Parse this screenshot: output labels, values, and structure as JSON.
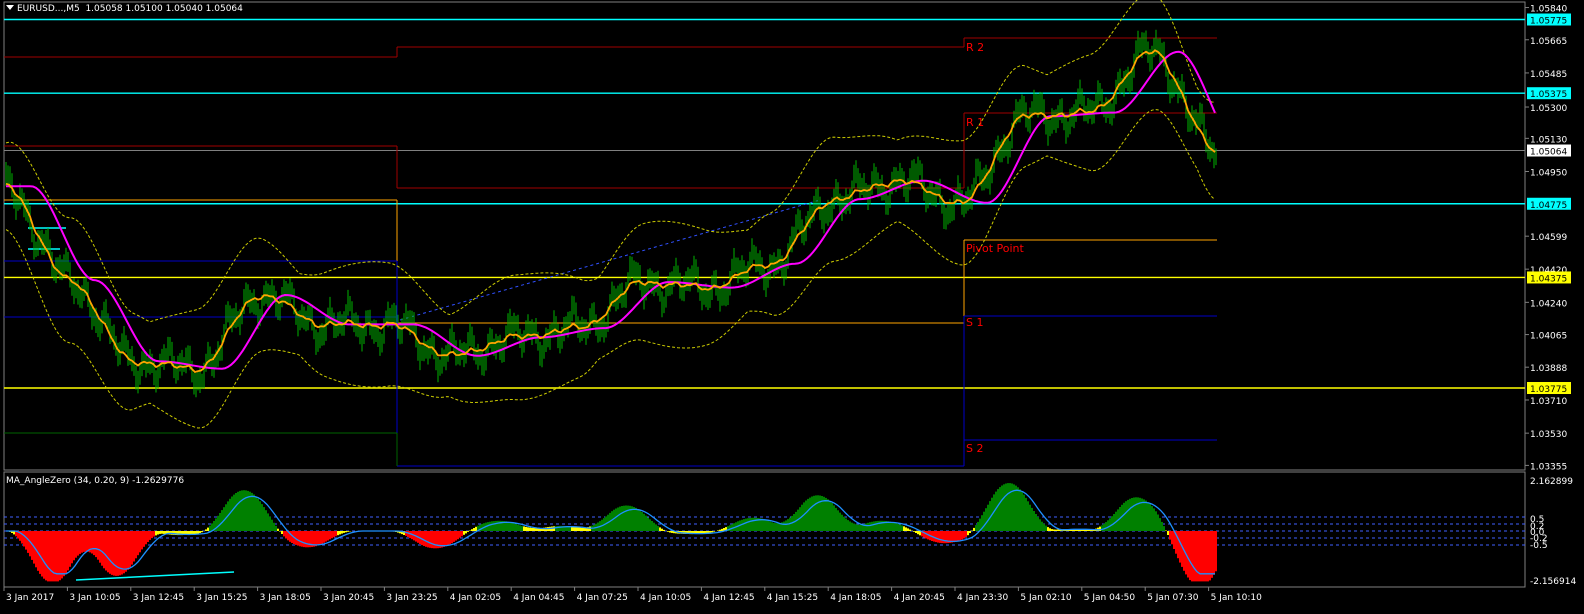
{
  "main_panel": {
    "symbol_label": "EURUSD...,M5",
    "ohlc": "1.05058 1.05100 1.05040 1.05064",
    "price_scale": [
      "1.05840",
      "1.05665",
      "1.05485",
      "1.05300",
      "1.05130",
      "1.04950",
      "1.04599",
      "1.04420",
      "1.04240",
      "1.04065",
      "1.03888",
      "1.03710",
      "1.03530",
      "1.03355"
    ],
    "price_range": [
      1.0333,
      1.0587
    ],
    "markers": [
      {
        "value": "1.05775",
        "price": 1.05775,
        "bg": "#00ffff",
        "fg": "#000000"
      },
      {
        "value": "1.05375",
        "price": 1.05375,
        "bg": "#00ffff",
        "fg": "#000000"
      },
      {
        "value": "1.05064",
        "price": 1.05064,
        "bg": "#ffffff",
        "fg": "#000000"
      },
      {
        "value": "1.04775",
        "price": 1.04775,
        "bg": "#00ffff",
        "fg": "#000000"
      },
      {
        "value": "1.04375",
        "price": 1.04375,
        "bg": "#ffff00",
        "fg": "#000000"
      },
      {
        "value": "1.03775",
        "price": 1.03775,
        "bg": "#ffff00",
        "fg": "#000000"
      }
    ],
    "pivot_labels": {
      "r2": "R 2",
      "r1": "R 1",
      "pp": "Pivot Point",
      "s1": "S 1",
      "s2": "S 2"
    }
  },
  "indicator_panel": {
    "title": "MA_AngleZero (34, 0.20, 9) -1.2629776",
    "scale": [
      "2.162899",
      "0.5",
      "0.2",
      "0.0",
      "-0.2",
      "-0.5",
      "-2.156914"
    ]
  },
  "time_axis": [
    "3 Jan 2017",
    "3 Jan 10:05",
    "3 Jan 12:45",
    "3 Jan 15:25",
    "3 Jan 18:05",
    "3 Jan 20:45",
    "3 Jan 23:25",
    "4 Jan 02:05",
    "4 Jan 04:45",
    "4 Jan 07:25",
    "4 Jan 10:05",
    "4 Jan 12:45",
    "4 Jan 15:25",
    "4 Jan 18:05",
    "4 Jan 20:45",
    "4 Jan 23:30",
    "5 Jan 02:10",
    "5 Jan 04:50",
    "5 Jan 07:30",
    "5 Jan 10:10"
  ],
  "chart_data": {
    "type": "line",
    "title": "EURUSD...,M5",
    "x": [
      "3 Jan 2017",
      "3 Jan 10:05",
      "3 Jan 12:45",
      "3 Jan 15:25",
      "3 Jan 18:05",
      "3 Jan 20:45",
      "3 Jan 23:25",
      "4 Jan 02:05",
      "4 Jan 04:45",
      "4 Jan 07:25",
      "4 Jan 10:05",
      "4 Jan 12:45",
      "4 Jan 15:25",
      "4 Jan 18:05",
      "4 Jan 20:45",
      "4 Jan 23:30",
      "5 Jan 02:10",
      "5 Jan 04:50",
      "5 Jan 07:30",
      "5 Jan 10:10"
    ],
    "series": [
      {
        "values": [
          1.0487,
          1.0436,
          1.0392,
          1.0388,
          1.0428,
          1.0412,
          1.0412,
          1.0395,
          1.0405,
          1.041,
          1.0435,
          1.0432,
          1.0445,
          1.048,
          1.049,
          1.0478,
          1.0525,
          1.0527,
          1.056,
          1.0506
        ]
      }
    ],
    "ylim": [
      1.0333,
      1.0587
    ],
    "grid": false,
    "colors": {
      "price": "#00b400",
      "ma_fast": "#ffa500",
      "ma_slow": "#ff00ff",
      "bands": "#cccc00",
      "histogram_pos": "#008000",
      "histogram_neg": "#ff0000"
    }
  }
}
